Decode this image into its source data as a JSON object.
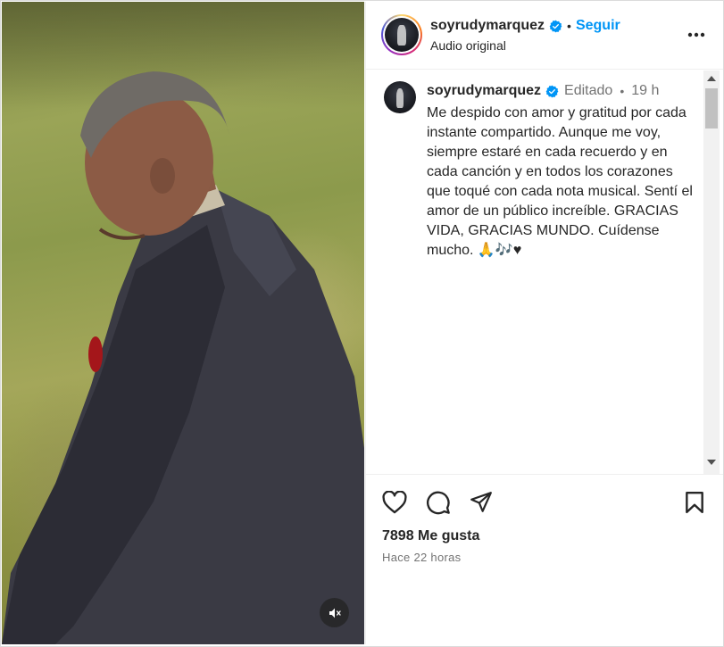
{
  "header": {
    "username": "soyrudymarquez",
    "separator": "•",
    "follow_label": "Seguir",
    "audio_label": "Audio original",
    "verified_icon": "verified-badge-icon",
    "more_icon": "more-options-icon"
  },
  "caption": {
    "username": "soyrudymarquez",
    "edited_label": "Editado",
    "separator": "•",
    "time": "19 h",
    "text": "Me despido con amor y gratitud por cada instante compartido. Aunque me voy, siempre estaré en cada recuerdo y en cada canción y en todos los corazones que toqué con cada nota musical. Sentí el amor de un público increíble. GRACIAS VIDA, GRACIAS MUNDO. Cuídense mucho. 🙏🎶♥"
  },
  "actions": {
    "like_icon": "heart-icon",
    "comment_icon": "comment-icon",
    "share_icon": "share-icon",
    "save_icon": "bookmark-icon",
    "likes_label": "7898 Me gusta",
    "posted_ago": "Hace 22 horas"
  },
  "media": {
    "mute_icon": "muted-speaker-icon"
  },
  "colors": {
    "accent": "#0095f6",
    "verified": "#0095f6",
    "text": "#262626",
    "muted_text": "#737373"
  }
}
